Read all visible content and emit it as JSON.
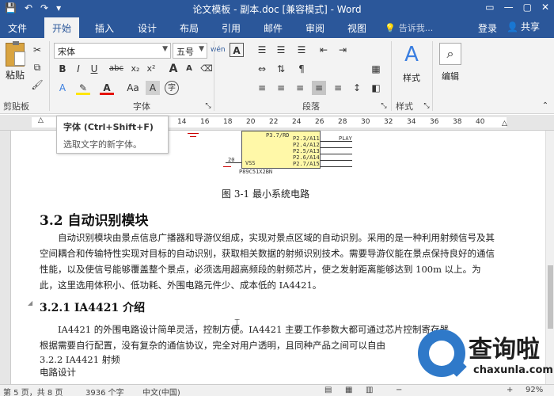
{
  "window": {
    "title": "论文模板 - 副本.doc [兼容模式] - Word",
    "quick_access": [
      "💾",
      "↶",
      "↷",
      "▾"
    ],
    "controls": [
      "▭",
      "—",
      "▢",
      "✕"
    ]
  },
  "tabs": [
    "文件",
    "开始",
    "插入",
    "设计",
    "布局",
    "引用",
    "邮件",
    "审阅",
    "视图"
  ],
  "tell_me": "告诉我...",
  "login": "登录",
  "share": "共享",
  "ribbon": {
    "clipboard": {
      "paste_label": "粘贴",
      "group_label": "剪贴板"
    },
    "font": {
      "font_name": "宋体",
      "font_size": "五号",
      "wen_label": "wén",
      "buttons": [
        "B",
        "I",
        "U",
        "abc",
        "x₂",
        "x²"
      ],
      "grow": "A",
      "shrink": "A",
      "aa_label": "Aa",
      "group_label": "字体"
    },
    "paragraph": {
      "group_label": "段落"
    },
    "styles": {
      "label": "样式",
      "group_label": "样式"
    },
    "editing": {
      "label": "编辑"
    }
  },
  "tooltip": {
    "title": "字体 (Ctrl+Shift+F)",
    "description": "选取文字的新字体。"
  },
  "ruler": {
    "numbers": [
      "14",
      "16",
      "18",
      "20",
      "22",
      "24",
      "26",
      "28",
      "30",
      "32",
      "34",
      "36",
      "38",
      "40"
    ]
  },
  "document": {
    "circuit_pins": [
      "P3.7/RD",
      "P2.3/A11",
      "P2.4/A12",
      "P2.5/A13",
      "P2.6/A14",
      "P2.7/A15",
      "VSS",
      "P89C51X2BN",
      "PLAY",
      "20"
    ],
    "caption": "图 3-1  最小系统电路",
    "heading_2": "3.2  自动识别模块",
    "paragraph_1": "　　自动识别模块由景点信息广播器和导游仪组成，实现对景点区域的自动识别。采用的是一种利用射频信号及其空间耦合和传输特性实现对目标的自动识别，获取相关数据的射频识别技术。需要导游仪能在景点保持良好的通信性能，以及使信号能够覆盖整个景点，必须选用超高频段的射频芯片，使之发射距离能够达到 100m 以上。为此，这里选用体积小、低功耗、外围电路元件少、成本低的 IA4421。",
    "heading_3": "3.2.1 IA4421 介绍",
    "line_1": "　　IA4421 的外围电路设计简单灵活，控制方便。IA4421 主要工作参数大都可通过芯片控制寄存器",
    "line_2": "根据需要自行配置，没有复杂的通信协议，完全对用户透明，且同种产品之间可以自由",
    "line_3": "3.2.2  IA4421 射频",
    "line_4": "电路设计"
  },
  "status_bar": {
    "page": "第 5 页，共 8 页",
    "words": "3936 个字",
    "language": "中文(中国)",
    "zoom": "92%"
  },
  "watermark": {
    "text": "查询啦",
    "url": "chaxunla.com"
  }
}
